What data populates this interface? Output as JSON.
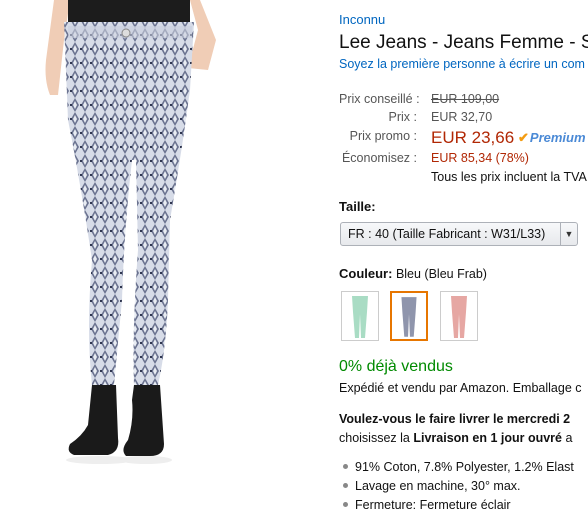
{
  "product": {
    "brand": "Inconnu",
    "title": "Lee Jeans - Jeans Femme - S",
    "reviews_link": "Soyez la première personne à écrire un com"
  },
  "pricing": {
    "list_price_label": "Prix conseillé :",
    "list_price": "EUR 109,00",
    "price_label": "Prix :",
    "price": "EUR 32,70",
    "promo_label": "Prix promo :",
    "promo_price": "EUR 23,66",
    "prime_label": "Premium",
    "savings_label": "Économisez :",
    "savings": "EUR 85,34 (78%)",
    "vat_note": "Tous les prix incluent la TVA"
  },
  "size": {
    "label": "Taille:",
    "selected": "FR : 40 (Taille Fabricant : W31/L33)"
  },
  "color": {
    "label": "Couleur:",
    "value": "Bleu (Bleu Frab)",
    "swatches": [
      "mint",
      "grey-print",
      "pink"
    ],
    "selected_index": 1
  },
  "availability": {
    "stock": "0% déjà vendus",
    "shipped_by": "Expédié et vendu par Amazon. Emballage c"
  },
  "delivery": {
    "question": "Voulez-vous le faire livrer le mercredi 2",
    "line_prefix": "choisissez la ",
    "line_bold": "Livraison en 1 jour ouvré",
    "line_suffix": " a"
  },
  "features": [
    "91% Coton, 7.8% Polyester, 1.2% Elast",
    "Lavage en machine, 30° max.",
    "Fermeture: Fermeture éclair"
  ],
  "colors": {
    "link": "#0066c0",
    "price_red": "#b12704",
    "stock_green": "#008a00",
    "selected_border": "#e77600"
  }
}
